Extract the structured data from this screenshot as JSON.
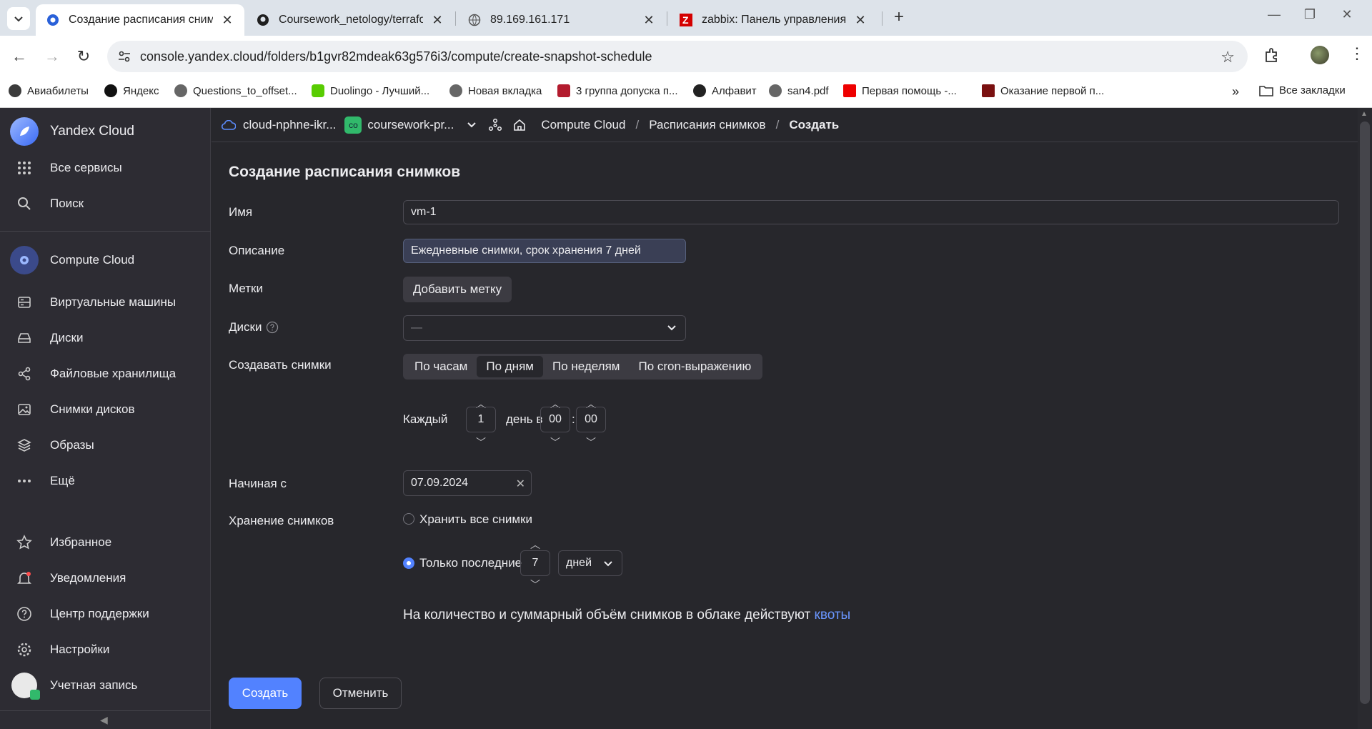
{
  "browser": {
    "tabs": [
      {
        "title": "Создание расписания снимко"
      },
      {
        "title": "Coursework_netology/terraform"
      },
      {
        "title": "89.169.161.171"
      },
      {
        "title": "zabbix: Панель управления"
      }
    ],
    "url": "console.yandex.cloud/folders/b1gvr82mdeak63g576i3/compute/create-snapshot-schedule",
    "bookmarks": [
      "Авиабилеты",
      "Яндекс",
      "Questions_to_offset...",
      "Duolingo - Лучший...",
      "Новая вкладка",
      "3 группа допуска п...",
      "Алфавит",
      "san4.pdf",
      "Первая помощь -...",
      "Оказание первой п..."
    ],
    "all_bookmarks": "Все закладки"
  },
  "sidebar": {
    "brand": "Yandex Cloud",
    "top": [
      {
        "label": "Все сервисы",
        "icon": "grid-icon"
      },
      {
        "label": "Поиск",
        "icon": "search-icon"
      }
    ],
    "service": "Compute Cloud",
    "items": [
      {
        "label": "Виртуальные машины",
        "icon": "vm-icon"
      },
      {
        "label": "Диски",
        "icon": "disk-icon"
      },
      {
        "label": "Файловые хранилища",
        "icon": "share-icon"
      },
      {
        "label": "Снимки дисков",
        "icon": "image-icon"
      },
      {
        "label": "Образы",
        "icon": "layers-icon"
      },
      {
        "label": "Ещё",
        "icon": "more-icon"
      }
    ],
    "bottom": [
      {
        "label": "Избранное",
        "icon": "star-icon"
      },
      {
        "label": "Уведомления",
        "icon": "bell-icon"
      },
      {
        "label": "Центр поддержки",
        "icon": "help-icon"
      },
      {
        "label": "Настройки",
        "icon": "gear-icon"
      },
      {
        "label": "Учетная запись",
        "icon": "avatar-icon"
      }
    ]
  },
  "topbar": {
    "cloud": "cloud-nphne-ikr...",
    "folder_badge": "co",
    "folder": "coursework-pr...",
    "crumbs": [
      "Compute Cloud",
      "Расписания снимков",
      "Создать"
    ]
  },
  "form": {
    "title": "Создание расписания снимков",
    "name_label": "Имя",
    "name_value": "vm-1",
    "desc_label": "Описание",
    "desc_value": "Ежедневные снимки, срок хранения 7 дней",
    "tags_label": "Метки",
    "tags_button": "Добавить метку",
    "disks_label": "Диски",
    "disks_value": "—",
    "create_label": "Создавать снимки",
    "segments": [
      "По часам",
      "По дням",
      "По неделям",
      "По cron-выражению"
    ],
    "selected_segment": "По дням",
    "every": "Каждый",
    "every_value": "1",
    "day_at": "день в",
    "hour": "00",
    "colon": ":",
    "minute": "00",
    "start_label": "Начиная с",
    "start_value": "07.09.2024",
    "retention_label": "Хранение снимков",
    "keep_all": "Хранить все снимки",
    "only_last": "Только последние",
    "only_last_value": "7",
    "unit": "дней",
    "quota_text": "На количество и суммарный объём снимков в облаке действуют",
    "quota_link": "квоты",
    "submit": "Создать",
    "cancel": "Отменить"
  },
  "colors": {
    "accent": "#5282ff",
    "background": "#27272c",
    "sidebar": "#2d2c33"
  }
}
